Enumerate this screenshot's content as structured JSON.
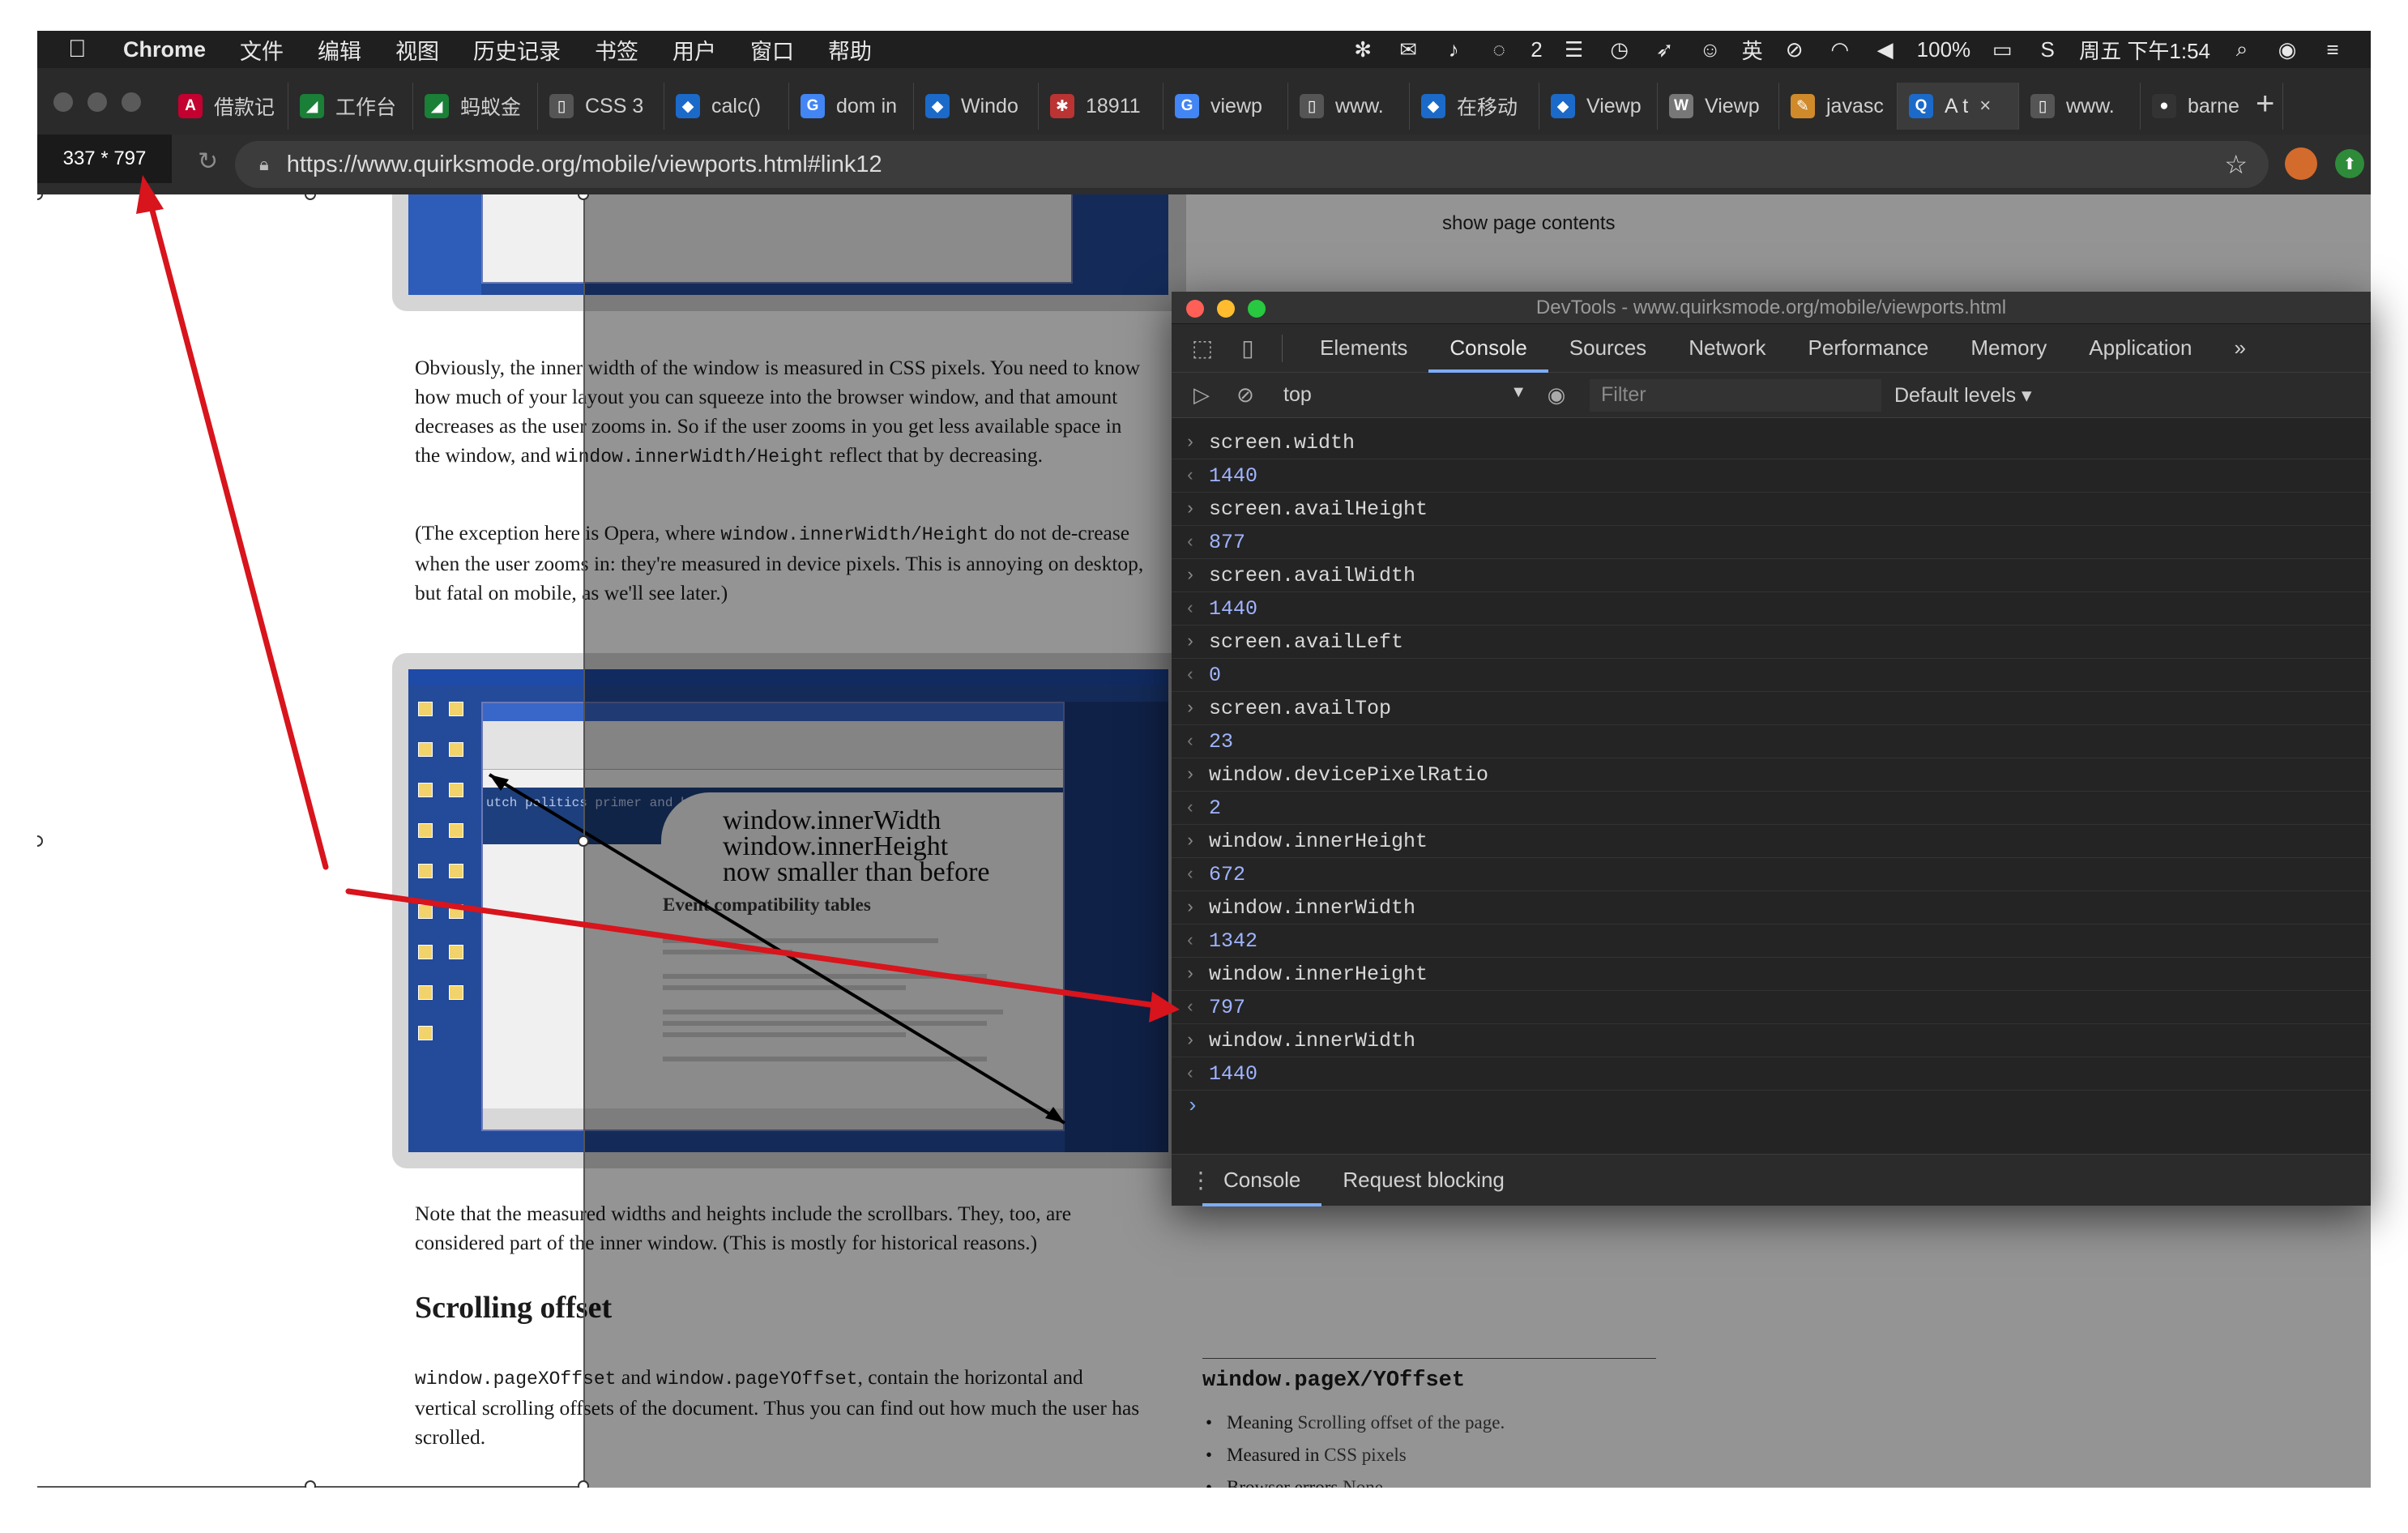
{
  "menubar": {
    "app": "Chrome",
    "items": [
      "文件",
      "编辑",
      "视图",
      "历史记录",
      "书签",
      "用户",
      "窗口",
      "帮助"
    ],
    "chat_count": "2",
    "ime": "英",
    "battery": "100%",
    "clock": "周五 下午1:54"
  },
  "tabs": [
    {
      "label": "借款记",
      "icon": "angular-icon",
      "color": "#c3002f",
      "glyph": "A"
    },
    {
      "label": "工作台",
      "icon": "ant-icon",
      "color": "#1a7f37",
      "glyph": "◢"
    },
    {
      "label": "蚂蚁金",
      "icon": "ant-icon",
      "color": "#1a7f37",
      "glyph": "◢"
    },
    {
      "label": "CSS 3",
      "icon": "page-icon",
      "color": "#555555",
      "glyph": "▯"
    },
    {
      "label": "calc()",
      "icon": "mdn-icon",
      "color": "#1b6ac9",
      "glyph": "◆"
    },
    {
      "label": "dom in",
      "icon": "google-icon",
      "color": "#4285f4",
      "glyph": "G"
    },
    {
      "label": "Windo",
      "icon": "mdn-icon",
      "color": "#1b6ac9",
      "glyph": "◆"
    },
    {
      "label": "18911",
      "icon": "bug-icon",
      "color": "#b33",
      "glyph": "✱"
    },
    {
      "label": "viewp",
      "icon": "google-icon",
      "color": "#4285f4",
      "glyph": "G"
    },
    {
      "label": "www.",
      "icon": "page-icon",
      "color": "#555555",
      "glyph": "▯"
    },
    {
      "label": "在移动",
      "icon": "mdn-icon",
      "color": "#1b6ac9",
      "glyph": "◆"
    },
    {
      "label": "Viewp",
      "icon": "mdn-icon",
      "color": "#1b6ac9",
      "glyph": "◆"
    },
    {
      "label": "Viewp",
      "icon": "wikipedia-icon",
      "color": "#777777",
      "glyph": "W"
    },
    {
      "label": "javasc",
      "icon": "script-icon",
      "color": "#d08a2a",
      "glyph": "✎"
    },
    {
      "label": "A t",
      "icon": "quirksmode-icon",
      "color": "#1b6ac9",
      "glyph": "Q",
      "active": true
    },
    {
      "label": "www.",
      "icon": "page-icon",
      "color": "#555555",
      "glyph": "▯"
    },
    {
      "label": "barne",
      "icon": "github-icon",
      "color": "#333333",
      "glyph": "●"
    }
  ],
  "address": {
    "viewport_size": "337 * 797",
    "url": "https://www.quirksmode.org/mobile/viewports.html#link12"
  },
  "page": {
    "show_contents": "show page contents",
    "p1": {
      "t1": "Obviously, the inner width of the window is measured in CSS pixels. You need to know how much of your layout you can squeeze into the browser window, and that amount decreases as the user zooms in. So if the user zooms in you get less available space in the window, and ",
      "code": "window.innerWidth/Height",
      "t2": " reflect that by decreasing."
    },
    "p2": {
      "t1": "(The exception here is Opera, where ",
      "code": "window.innerWidth/Height",
      "t2": " do not de-crease when the user zooms in: they're measured in device pixels. This is annoying on desktop, but fatal on mobile, as we'll see later.)"
    },
    "figure": {
      "line1": "window.innerWidth",
      "line2": "window.innerHeight",
      "line3": "now smaller than before",
      "sub": "Event compatibility tables",
      "banner": "utch politics primer and blog"
    },
    "p3": "Note that the measured widths and heights include the scrollbars. They, too, are considered part of the inner window. (This is mostly for historical reasons.)",
    "heading": "Scrolling offset",
    "p4": {
      "code1": "window.pageXOffset",
      "t1": " and ",
      "code2": "window.pageYOffset",
      "t2": ", contain the horizontal and vertical scrolling offsets of the document. Thus you can find out how much the user has scrolled."
    },
    "sidebar": {
      "title": "window.pageX/YOffset",
      "items": [
        {
          "key": "Meaning",
          "val": "Scrolling offset of the page."
        },
        {
          "key": "Measured in",
          "val": "CSS pixels"
        },
        {
          "key": "Browser errors",
          "val": "None"
        }
      ]
    }
  },
  "devtools": {
    "title": "DevTools - www.quirksmode.org/mobile/viewports.html",
    "tabs": [
      "Elements",
      "Console",
      "Sources",
      "Network",
      "Performance",
      "Memory",
      "Application"
    ],
    "active_tab": "Console",
    "more": "»",
    "context": "top",
    "filter_placeholder": "Filter",
    "levels": "Default levels",
    "console": [
      {
        "kind": "input",
        "text": "screen.width"
      },
      {
        "kind": "output",
        "text": "1440"
      },
      {
        "kind": "input",
        "text": "screen.availHeight"
      },
      {
        "kind": "output",
        "text": "877"
      },
      {
        "kind": "input",
        "text": "screen.availWidth"
      },
      {
        "kind": "output",
        "text": "1440"
      },
      {
        "kind": "input",
        "text": "screen.availLeft"
      },
      {
        "kind": "output",
        "text": "0"
      },
      {
        "kind": "input",
        "text": "screen.availTop"
      },
      {
        "kind": "output",
        "text": "23"
      },
      {
        "kind": "input",
        "text": "window.devicePixelRatio"
      },
      {
        "kind": "output",
        "text": "2"
      },
      {
        "kind": "input",
        "text": "window.innerHeight"
      },
      {
        "kind": "output",
        "text": "672"
      },
      {
        "kind": "input",
        "text": "window.innerWidth"
      },
      {
        "kind": "output",
        "text": "1342"
      },
      {
        "kind": "input",
        "text": "window.innerHeight"
      },
      {
        "kind": "output",
        "text": "797"
      },
      {
        "kind": "input",
        "text": "window.innerWidth"
      },
      {
        "kind": "output",
        "text": "1440"
      }
    ],
    "drawer_tabs": [
      "Console",
      "Request blocking"
    ]
  },
  "colors": {
    "annotation": "#d8141c",
    "console_output": "#9fb4ff",
    "active_tab_underline": "#7cacf8"
  }
}
